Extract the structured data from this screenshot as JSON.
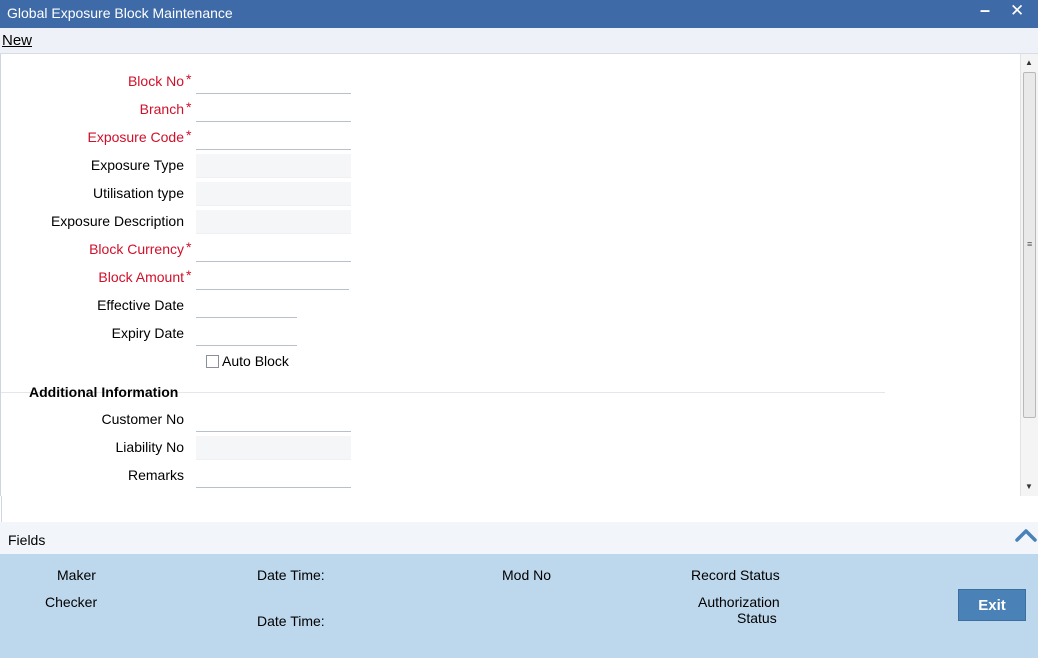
{
  "window": {
    "title": "Global Exposure Block Maintenance",
    "minimize_glyph": "▅",
    "close_glyph": "✕"
  },
  "toolbar": {
    "new_label": "New"
  },
  "form": {
    "block_no": {
      "label": "Block No",
      "value": ""
    },
    "branch": {
      "label": "Branch",
      "value": ""
    },
    "exposure_code": {
      "label": "Exposure Code",
      "value": ""
    },
    "exposure_type": {
      "label": "Exposure Type",
      "value": ""
    },
    "utilisation_type": {
      "label": "Utilisation type",
      "value": ""
    },
    "exposure_description": {
      "label": "Exposure Description",
      "value": ""
    },
    "block_currency": {
      "label": "Block Currency",
      "value": ""
    },
    "block_amount": {
      "label": "Block Amount",
      "value": ""
    },
    "effective_date": {
      "label": "Effective Date",
      "value": ""
    },
    "expiry_date": {
      "label": "Expiry Date",
      "value": ""
    },
    "auto_block": {
      "label": "Auto Block",
      "checked": false
    },
    "required_mark": "*"
  },
  "additional_info": {
    "title": "Additional Information",
    "customer_no": {
      "label": "Customer No",
      "value": ""
    },
    "liability_no": {
      "label": "Liability No",
      "value": ""
    },
    "remarks": {
      "label": "Remarks",
      "value": ""
    }
  },
  "fields_bar": {
    "label": "Fields"
  },
  "audit": {
    "maker": "Maker",
    "maker_date_time": "Date Time:",
    "checker": "Checker",
    "checker_date_time": "Date Time:",
    "mod_no": "Mod No",
    "record_status": "Record Status",
    "authorization_status_line1": "Authorization",
    "authorization_status_line2": "Status",
    "exit_label": "Exit"
  },
  "colors": {
    "titlebar": "#3e6aa8",
    "required_label": "#d0102a",
    "audit_panel": "#bdd7ec",
    "exit_button": "#4a82b8"
  }
}
